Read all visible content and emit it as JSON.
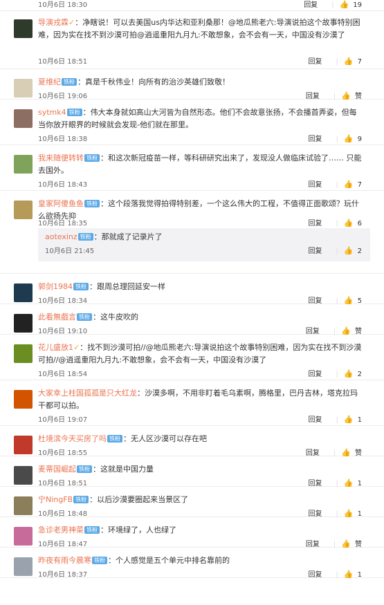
{
  "ui": {
    "reply": "回复",
    "like_empty": "赞"
  },
  "top": {
    "date": "10月6日 18:30",
    "likes": "19"
  },
  "comments": [
    {
      "name": "导演戎霖",
      "badge": "vip",
      "text": "：净瞎说！可以去美国us内华达和亚利桑那！@地瓜熊老六:导演说拍这个故事特别困难，因为实在找不到沙漠可拍@逍遥重阳九月九:不敢想象，会不会有一天，中国没有沙漠了",
      "date": "10月6日 18:51",
      "likes": "7",
      "avatar": "#2f3b2a"
    },
    {
      "name": "夏维纪",
      "badge": "铁粉",
      "text": "：真是千秋伟业！向所有的治沙英雄们致敬！",
      "date": "10月6日 19:06",
      "likes": "赞",
      "avatar": "#d8cdb5"
    },
    {
      "name": "sytmk4",
      "badge": "铁粉",
      "text": "：伟大本身就如高山大河皆为自然形态。他们不会故意张扬，不会播首弄姿，但每当你放开眼界的时候就会发现-他们就在那里。",
      "date": "10月6日 18:38",
      "likes": "9",
      "avatar": "#8d6e63"
    },
    {
      "name": "我来随便转转",
      "badge": "铁粉",
      "text": "：和这次新冠疫苗一样，等科研研究出来了，发现没人做临床试验了…… 只能去国外。",
      "date": "10月6日 18:43",
      "likes": "7",
      "avatar": "#7fa35a"
    },
    {
      "name": "皇家阿傻鱼鱼",
      "badge": "铁粉",
      "text": "：这个段落我觉得拍得特别差，一个这么伟大的工程，不值得正面歌颂？玩什么欲扬先抑",
      "date": "10月6日 18:35",
      "likes": "6",
      "avatar": "#b59a5a",
      "reply": {
        "name": "aotexinz",
        "badge": "铁粉",
        "text": "：那就成了记录片了",
        "date": "10月6日 21:45",
        "likes": "2"
      }
    },
    {
      "name": "郭剑1984",
      "badge": "铁粉",
      "text": "：跟周总理回延安一样",
      "date": "10月6日 18:34",
      "likes": "5",
      "avatar": "#1e3a4f"
    },
    {
      "name": "此看無戲言",
      "badge": "铁粉",
      "text": "：这牛皮吹的",
      "date": "10月6日 19:10",
      "likes": "赞",
      "avatar": "#222"
    },
    {
      "name": "花儿盛放1",
      "badge": "vip",
      "text": "：找不到沙漠可拍//@地瓜熊老六:导演说拍这个故事特别困难，因为实在找不到沙漠可拍//@逍遥重阳九月九:不敢想象，会不会有一天，中国没有沙漠了",
      "date": "10月6日 18:54",
      "likes": "2",
      "avatar": "#6b8e23"
    },
    {
      "name": "大家幸上柱国孤孤是只大红龙",
      "badge": "",
      "text": "：沙漠多啊，不用非盯着毛乌素啊，腾格里，巴丹吉林，塔克拉玛干都可以拍。",
      "date": "10月6日 19:07",
      "likes": "1",
      "avatar": "#d35400"
    },
    {
      "name": "杜境滨今天买房了吗",
      "badge": "铁粉",
      "text": "：无人区沙漠可以存在吧",
      "date": "10月6日 18:55",
      "likes": "赞",
      "avatar": "#c0392b"
    },
    {
      "name": "麦蒂国崛起",
      "badge": "铁粉",
      "text": "：这就是中国力量",
      "date": "10月6日 18:51",
      "likes": "1",
      "avatar": "#4a4a4a"
    },
    {
      "name": "宁NingFB",
      "badge": "铁粉",
      "text": "：以后沙漠要圈起来当景区了",
      "date": "10月6日 18:48",
      "likes": "1",
      "avatar": "#8a7f5a"
    },
    {
      "name": "急诊老男神菜",
      "badge": "铁粉",
      "text": "：环境绿了，人也绿了",
      "date": "10月6日 18:47",
      "likes": "赞",
      "avatar": "#c76b9a"
    },
    {
      "name": "昨夜有雨今晨寒",
      "badge": "铁粉",
      "text": "：个人感觉是五个单元中排名靠前的",
      "date": "10月6日 18:37",
      "likes": "1",
      "avatar": "#9aa3ad"
    }
  ]
}
